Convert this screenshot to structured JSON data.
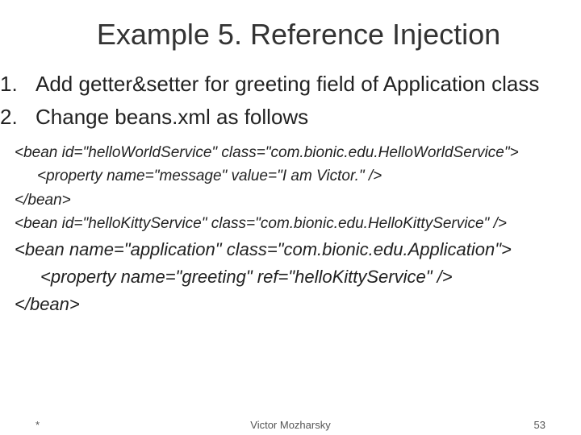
{
  "title": "Example 5. Reference Injection",
  "items": [
    {
      "num": "1.",
      "text": "Add getter&setter for greeting field of Application class"
    },
    {
      "num": "2.",
      "text": "Change beans.xml as follows"
    }
  ],
  "code": {
    "l1": "<bean id=\"helloWorldService\" class=\"com.bionic.edu.HelloWorldService\">",
    "l2": "<property name=\"message\" value=\"I am Victor.\" />",
    "l3": "</bean>",
    "l4": "<bean id=\"helloKittyService\" class=\"com.bionic.edu.HelloKittyService\" />",
    "l5": "<bean name=\"application\" class=\"com.bionic.edu.Application\">",
    "l6": "<property name=\"greeting\" ref=\"helloKittyService\" />",
    "l7": "</bean>"
  },
  "footer": {
    "mark": "*",
    "author": "Victor Mozharsky",
    "page": "53"
  }
}
